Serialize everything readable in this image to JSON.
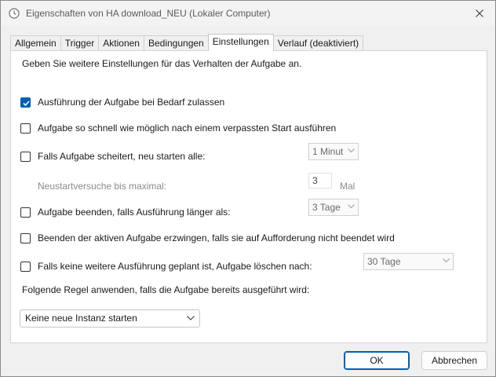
{
  "window": {
    "title": "Eigenschaften von HA download_NEU (Lokaler Computer)"
  },
  "tabs": [
    {
      "label": "Allgemein",
      "active": false
    },
    {
      "label": "Trigger",
      "active": false
    },
    {
      "label": "Aktionen",
      "active": false
    },
    {
      "label": "Bedingungen",
      "active": false
    },
    {
      "label": "Einstellungen",
      "active": true
    },
    {
      "label": "Verlauf (deaktiviert)",
      "active": false
    }
  ],
  "settings": {
    "intro": "Geben Sie weitere Einstellungen für das Verhalten der Aufgabe an.",
    "options": [
      {
        "label": "Ausführung der Aufgabe bei Bedarf zulassen",
        "checked": true
      },
      {
        "label": "Aufgabe so schnell wie möglich nach einem verpassten Start ausführen",
        "checked": false
      },
      {
        "label": "Falls Aufgabe scheitert, neu starten alle:",
        "checked": false
      },
      {
        "label": "Aufgabe beenden, falls Ausführung länger als:",
        "checked": false
      },
      {
        "label": "Beenden der aktiven Aufgabe erzwingen, falls sie auf Aufforderung nicht beendet wird",
        "checked": false
      },
      {
        "label": "Falls keine weitere Ausführung geplant ist, Aufgabe löschen nach:",
        "checked": false
      }
    ],
    "restart_interval": "1 Minut",
    "retry_label": "Neustartversuche bis maximal:",
    "retry_count": "3",
    "retry_unit": "Mal",
    "stop_after": "3 Tage",
    "delete_after": "30 Tage",
    "rule_label": "Folgende Regel anwenden, falls die Aufgabe bereits ausgeführt wird:",
    "rule_value": "Keine neue Instanz starten"
  },
  "buttons": {
    "ok": "OK",
    "cancel": "Abbrechen"
  },
  "colors": {
    "accent": "#005fb8"
  }
}
